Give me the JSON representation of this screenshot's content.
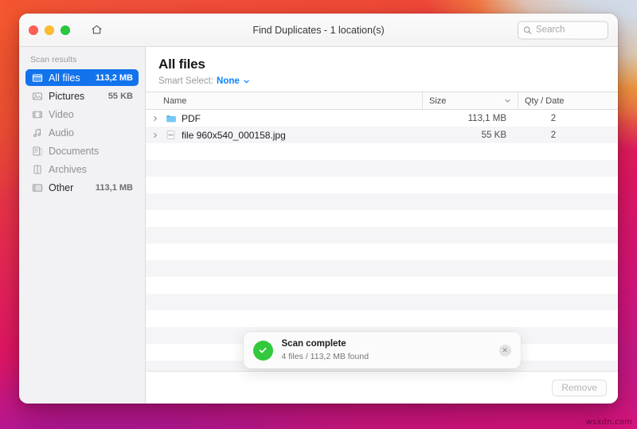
{
  "window": {
    "title": "Find Duplicates - 1 location(s)",
    "traffic_lights": [
      "close-button",
      "minimize-button",
      "maximize-button"
    ],
    "home_icon": "home-icon"
  },
  "search": {
    "placeholder": "Search",
    "value": "",
    "icon": "search-icon"
  },
  "sidebar": {
    "heading": "Scan results",
    "items": [
      {
        "label": "All files",
        "size": "113,2 MB",
        "icon": "all-files-icon",
        "selected": true,
        "dim": false
      },
      {
        "label": "Pictures",
        "size": "55 KB",
        "icon": "pictures-icon",
        "selected": false,
        "dim": false
      },
      {
        "label": "Video",
        "size": "",
        "icon": "video-icon",
        "selected": false,
        "dim": true
      },
      {
        "label": "Audio",
        "size": "",
        "icon": "audio-icon",
        "selected": false,
        "dim": true
      },
      {
        "label": "Documents",
        "size": "",
        "icon": "documents-icon",
        "selected": false,
        "dim": true
      },
      {
        "label": "Archives",
        "size": "",
        "icon": "archives-icon",
        "selected": false,
        "dim": true
      },
      {
        "label": "Other",
        "size": "113,1 MB",
        "icon": "other-icon",
        "selected": false,
        "dim": false
      }
    ]
  },
  "main": {
    "title": "All files",
    "smart_select_label": "Smart Select:",
    "smart_select_value": "None",
    "columns": {
      "name": "Name",
      "size": "Size",
      "qty_date": "Qty / Date"
    },
    "sorted_column": "Size",
    "rows": [
      {
        "name": "PDF",
        "size": "113,1 MB",
        "qty": "2",
        "icon": "folder-icon"
      },
      {
        "name": "file 960x540_000158.jpg",
        "size": "55 KB",
        "qty": "2",
        "icon": "image-file-icon"
      }
    ]
  },
  "toast": {
    "title": "Scan complete",
    "subtitle": "4 files / 113,2 MB found",
    "status_icon": "checkmark-icon",
    "close_icon": "close-icon",
    "close_glyph": "✕"
  },
  "footer": {
    "remove_label": "Remove",
    "remove_enabled": false
  },
  "watermark": "wsxdn.com",
  "colors": {
    "accent_blue": "#1273ec",
    "link_blue": "#0a84ff",
    "success_green": "#32c93c",
    "sidebar_bg": "#f2f1f4",
    "row_alt_bg": "#f5f5f7"
  }
}
